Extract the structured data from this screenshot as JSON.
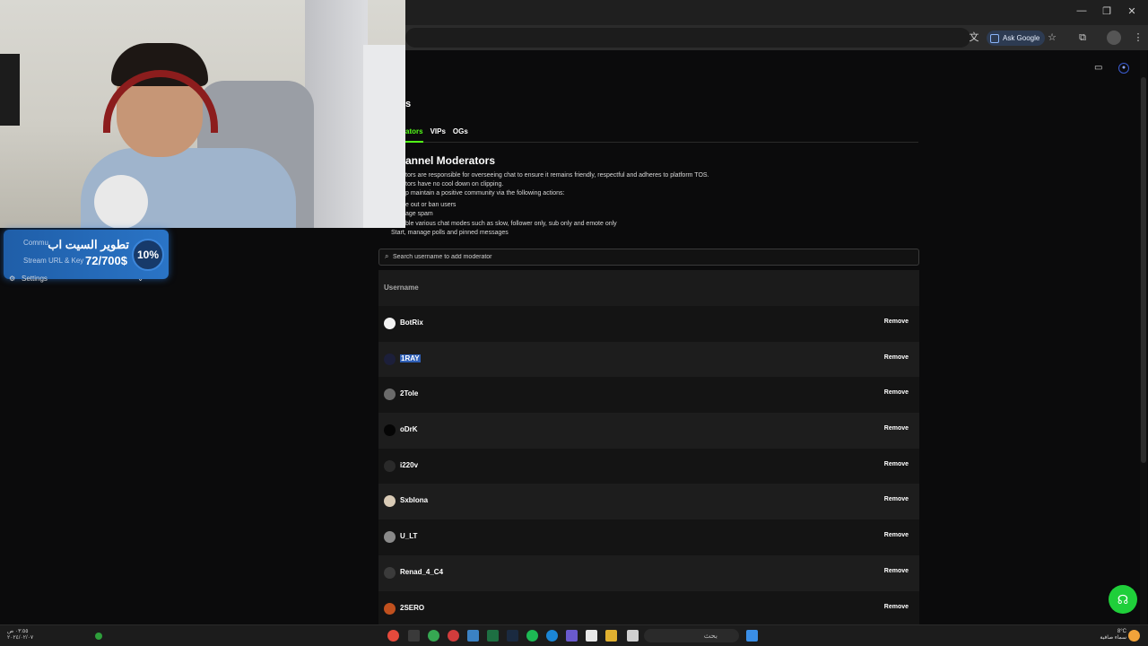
{
  "browser": {
    "ask_google": "Ask Google"
  },
  "donation": {
    "goal_title": "تطوير السيت اب",
    "amount": "72/700$",
    "percent": "10%",
    "underlay_1": "Commu",
    "underlay_2": "Stream URL & Key"
  },
  "sidebar": {
    "settings_label": "Settings"
  },
  "tabs": [
    {
      "label": "ators",
      "active": true
    },
    {
      "label": "VIPs",
      "active": false
    },
    {
      "label": "OGs",
      "active": false
    }
  ],
  "section": {
    "title": "annel Moderators",
    "desc_lines": [
      "tors are responsible for overseeing chat to ensure it remains friendly, respectful and adheres to platform TOS.",
      "tors have no cool down on clipping.",
      "p maintain a positive community via the following actions:"
    ],
    "bullets": [
      "e out or ban users",
      "age spam",
      "ble various chat modes such as slow, follower only, sub only and emote only",
      "Start, manage polls and pinned messages"
    ]
  },
  "search": {
    "placeholder": "Search username to add moderator"
  },
  "table": {
    "header": "Username",
    "remove_label": "Remove",
    "rows": [
      {
        "username": "BotRix",
        "avatar_color": "#f2f2f2",
        "selected": false
      },
      {
        "username": "1RAY",
        "avatar_color": "#1c1f3a",
        "selected": true
      },
      {
        "username": "2Tole",
        "avatar_color": "#6a6a6a",
        "selected": false
      },
      {
        "username": "oDrK",
        "avatar_color": "#050505",
        "selected": false
      },
      {
        "username": "i220v",
        "avatar_color": "#2a2a2a",
        "selected": false
      },
      {
        "username": "Sxblona",
        "avatar_color": "#d9cbb6",
        "selected": false
      },
      {
        "username": "U_LT",
        "avatar_color": "#8a8a8a",
        "selected": false
      },
      {
        "username": "Renad_4_C4",
        "avatar_color": "#3b3b3b",
        "selected": false
      },
      {
        "username": "2SERO",
        "avatar_color": "#c0501e",
        "selected": false
      }
    ]
  },
  "taskbar": {
    "search_label": "بحث",
    "clock_left": "٠٣:٥٥ ص",
    "date_left": "٢٠٢٤/٠٢/٠٧",
    "weather": "8°C",
    "weather_desc": "سماء صافية"
  },
  "colors": {
    "accent": "#53fc18",
    "selection": "#2f5fb5",
    "donation_bg": "#2a74c6"
  }
}
